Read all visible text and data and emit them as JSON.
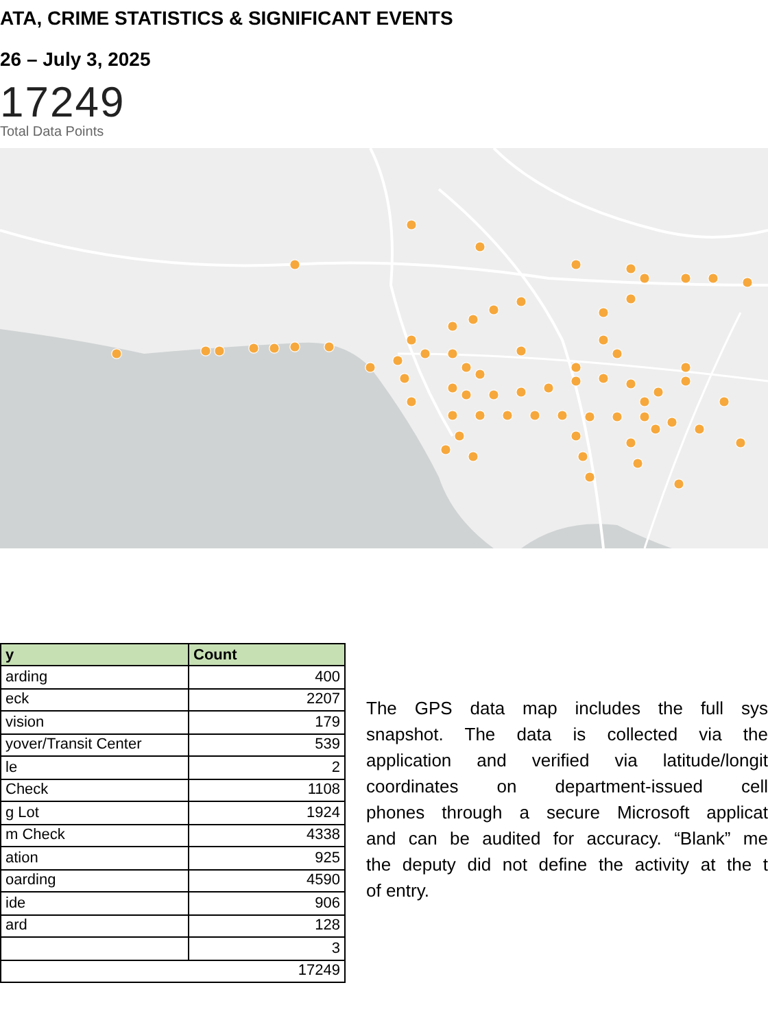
{
  "title": "ATA, CRIME STATISTICS & SIGNIFICANT EVENTS",
  "date_range": "26 – July 3, 2025",
  "metric": {
    "value": "17249",
    "label": "Total Data Points"
  },
  "table": {
    "columns": [
      "y",
      "Count"
    ],
    "rows": [
      {
        "activity": "arding",
        "count": "400"
      },
      {
        "activity": "eck",
        "count": "2207"
      },
      {
        "activity": "vision",
        "count": "179"
      },
      {
        "activity": "yover/Transit Center",
        "count": "539"
      },
      {
        "activity": "le",
        "count": "2"
      },
      {
        "activity": "Check",
        "count": "1108"
      },
      {
        "activity": "g Lot",
        "count": "1924"
      },
      {
        "activity": "m Check",
        "count": "4338"
      },
      {
        "activity": "ation",
        "count": "925"
      },
      {
        "activity": "oarding",
        "count": "4590"
      },
      {
        "activity": "ide",
        "count": "906"
      },
      {
        "activity": "ard",
        "count": "128"
      },
      {
        "activity": "",
        "count": "3"
      }
    ],
    "total": "17249"
  },
  "note_lines": [
    "The GPS data map includes the full sys",
    "snapshot. The data is collected via the",
    "application and verified via latitude/longit",
    "coordinates on department-issued cell",
    "phones through a secure Microsoft applicat",
    "and can be audited for accuracy. “Blank” me",
    "the deputy did not define the activity at the t",
    "of entry."
  ]
}
